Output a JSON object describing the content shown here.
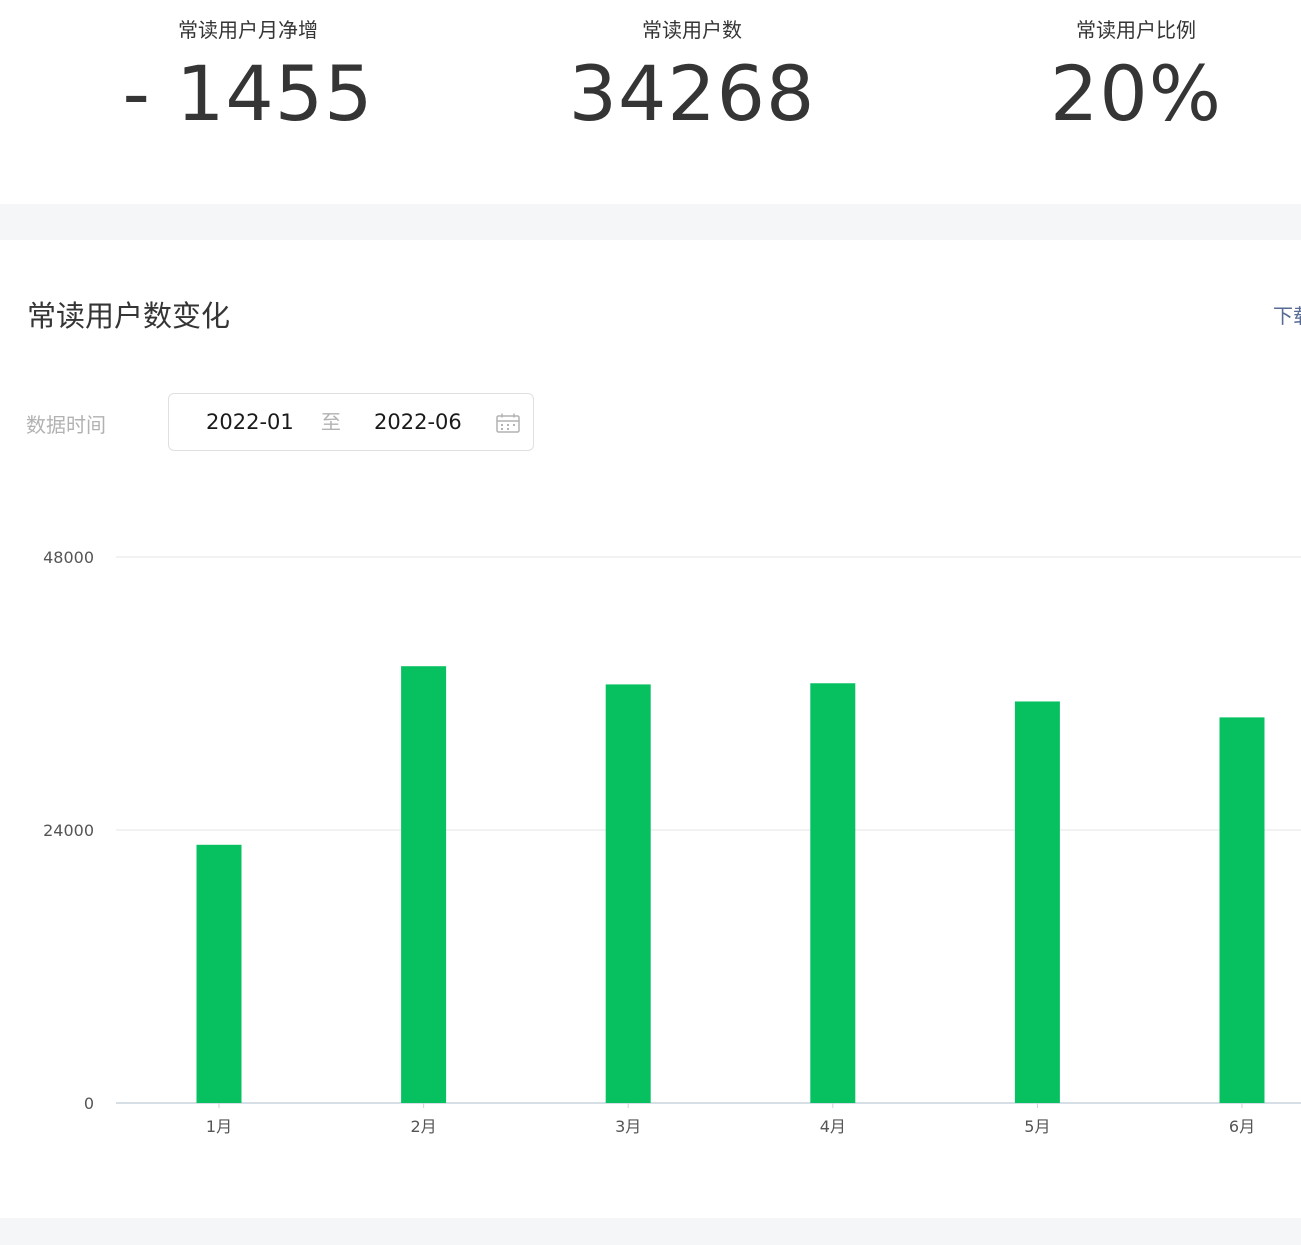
{
  "stats": [
    {
      "label": "常读用户月净增",
      "value": "- 1455"
    },
    {
      "label": "常读用户数",
      "value": "34268"
    },
    {
      "label": "常读用户比例",
      "value": "20%"
    }
  ],
  "section": {
    "title": "常读用户数变化",
    "download_label": "下载"
  },
  "filter": {
    "label": "数据时间",
    "start": "2022-01",
    "separator": "至",
    "end": "2022-06",
    "icon": "calendar-icon"
  },
  "colors": {
    "bar": "#07c160",
    "grid": "#e5e5e5",
    "axis": "#c9d3de",
    "link": "#576b95"
  },
  "chart_data": {
    "type": "bar",
    "categories": [
      "1月",
      "2月",
      "3月",
      "4月",
      "5月",
      "6月"
    ],
    "values": [
      22700,
      38400,
      36800,
      36900,
      35300,
      33900
    ],
    "y_ticks": [
      0,
      24000,
      48000
    ],
    "ylim": [
      0,
      48000
    ],
    "grid": true,
    "legend": "none"
  }
}
